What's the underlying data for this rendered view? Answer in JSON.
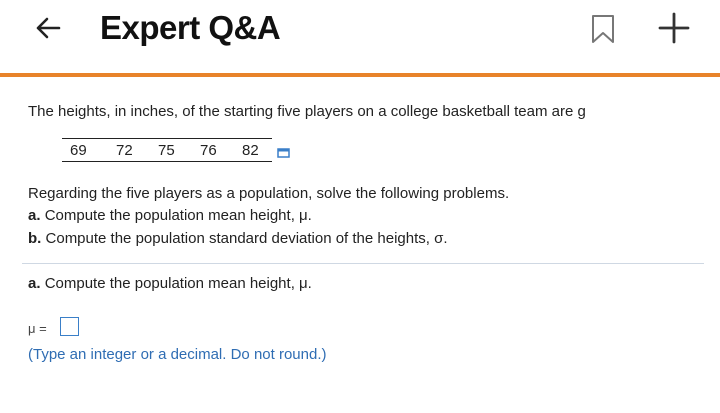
{
  "header": {
    "title": "Expert Q&A",
    "accent_color": "#e8832a"
  },
  "icons": {
    "back": "arrow-left-icon",
    "bookmark": "bookmark-icon",
    "add": "plus-icon",
    "copy": "copy-data-icon"
  },
  "question": {
    "intro": "The heights, in inches, of the starting five players on a college basketball team are g",
    "data_values": [
      "69",
      "72",
      "75",
      "76",
      "82"
    ],
    "instruction": "Regarding the five players as a population, solve the following problems.",
    "part_a": {
      "letter": "a.",
      "text": "Compute the population mean height, μ."
    },
    "part_b": {
      "letter": "b.",
      "text": "Compute the population standard deviation of the heights, σ."
    }
  },
  "answer_section": {
    "part_letter": "a.",
    "part_text": "Compute the population mean height, μ.",
    "mu_label": "μ =",
    "answer_value": "",
    "hint": "(Type an integer or a decimal. Do not round.)"
  }
}
